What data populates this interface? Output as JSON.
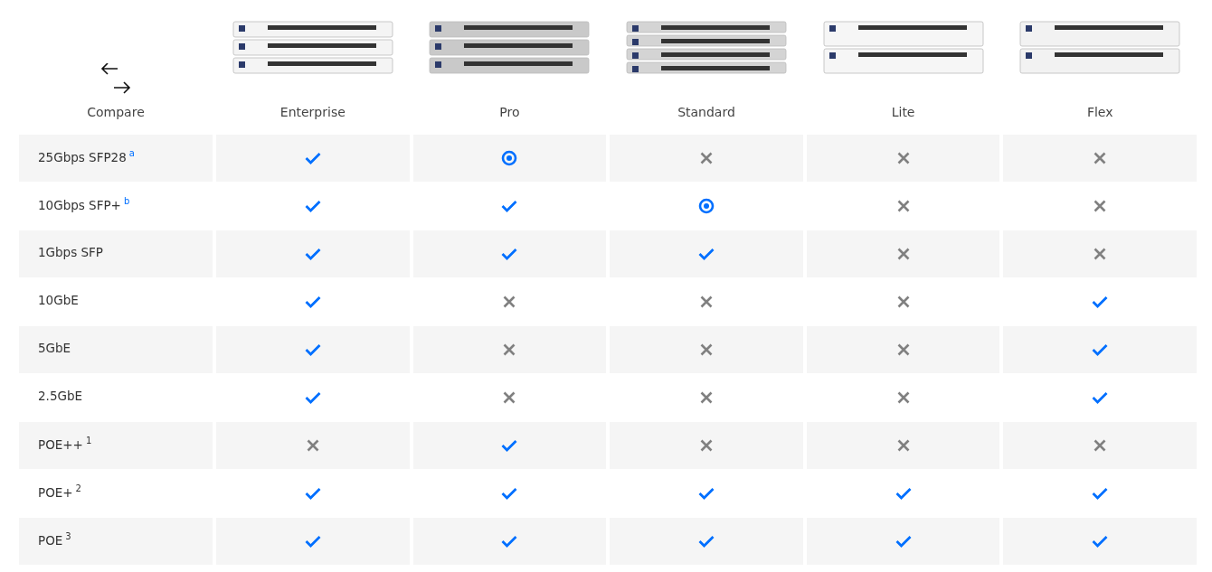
{
  "compare_label": "Compare",
  "products": [
    {
      "name": "Enterprise"
    },
    {
      "name": "Pro"
    },
    {
      "name": "Standard"
    },
    {
      "name": "Lite"
    },
    {
      "name": "Flex"
    }
  ],
  "rows": [
    {
      "feature": "25Gbps SFP28",
      "note": {
        "text": "a",
        "kind": "link"
      },
      "cells": [
        {
          "kind": "yes"
        },
        {
          "kind": "partial"
        },
        {
          "kind": "no"
        },
        {
          "kind": "no"
        },
        {
          "kind": "no"
        }
      ]
    },
    {
      "feature": "10Gbps SFP+",
      "note": {
        "text": "b",
        "kind": "link"
      },
      "cells": [
        {
          "kind": "yes"
        },
        {
          "kind": "yes"
        },
        {
          "kind": "partial"
        },
        {
          "kind": "no"
        },
        {
          "kind": "no"
        }
      ]
    },
    {
      "feature": "1Gbps SFP",
      "cells": [
        {
          "kind": "yes"
        },
        {
          "kind": "yes"
        },
        {
          "kind": "yes"
        },
        {
          "kind": "no"
        },
        {
          "kind": "no"
        }
      ]
    },
    {
      "feature": "10GbE",
      "cells": [
        {
          "kind": "yes"
        },
        {
          "kind": "no"
        },
        {
          "kind": "no"
        },
        {
          "kind": "no"
        },
        {
          "kind": "yes"
        }
      ]
    },
    {
      "feature": "5GbE",
      "cells": [
        {
          "kind": "yes"
        },
        {
          "kind": "no"
        },
        {
          "kind": "no"
        },
        {
          "kind": "no"
        },
        {
          "kind": "yes"
        }
      ]
    },
    {
      "feature": "2.5GbE",
      "cells": [
        {
          "kind": "yes"
        },
        {
          "kind": "no"
        },
        {
          "kind": "no"
        },
        {
          "kind": "no"
        },
        {
          "kind": "yes"
        }
      ]
    },
    {
      "feature": "POE++",
      "note": {
        "text": "1",
        "kind": "plain"
      },
      "cells": [
        {
          "kind": "no"
        },
        {
          "kind": "yes"
        },
        {
          "kind": "no"
        },
        {
          "kind": "no"
        },
        {
          "kind": "no"
        }
      ]
    },
    {
      "feature": "POE+",
      "note": {
        "text": "2",
        "kind": "plain"
      },
      "cells": [
        {
          "kind": "yes"
        },
        {
          "kind": "yes"
        },
        {
          "kind": "yes"
        },
        {
          "kind": "yes"
        },
        {
          "kind": "yes"
        }
      ]
    },
    {
      "feature": "POE",
      "note": {
        "text": "3",
        "kind": "plain"
      },
      "cells": [
        {
          "kind": "yes"
        },
        {
          "kind": "yes"
        },
        {
          "kind": "yes"
        },
        {
          "kind": "yes"
        },
        {
          "kind": "yes"
        }
      ]
    }
  ]
}
